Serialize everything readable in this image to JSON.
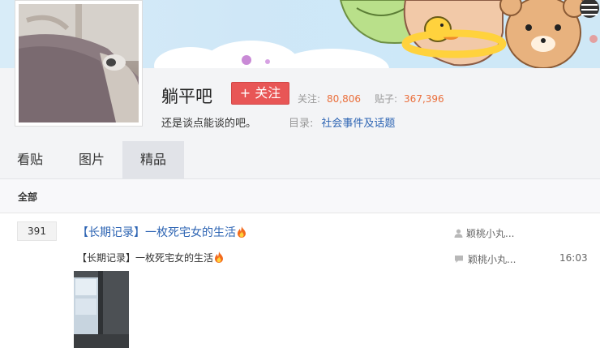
{
  "forum": {
    "name": "躺平吧",
    "follow_label": "+ 关注",
    "slogan": "还是谈点能谈的吧。",
    "stats": {
      "follow_label": "关注:",
      "follow_count": "80,806",
      "posts_label": "贴子:",
      "posts_count": "367,396"
    },
    "directory_label": "目录:",
    "directory_link": "社会事件及话题"
  },
  "tabs": [
    {
      "label": "看贴",
      "active": false
    },
    {
      "label": "图片",
      "active": false
    },
    {
      "label": "精品",
      "active": true
    }
  ],
  "filter": {
    "label": "全部"
  },
  "threads": [
    {
      "reply_count": "391",
      "title": "【长期记录】一枚死宅女的生活",
      "abstract": "【长期记录】一枚死宅女的生活",
      "author": "颖桃小丸...",
      "last_reply_user": "颖桃小丸...",
      "last_reply_time": "16:03"
    }
  ],
  "colors": {
    "follow_button": "#e85656",
    "link": "#2d64b3",
    "stat_number": "#ea6f3c"
  },
  "icons": [
    "user-icon",
    "comment-icon",
    "fire-icon"
  ]
}
